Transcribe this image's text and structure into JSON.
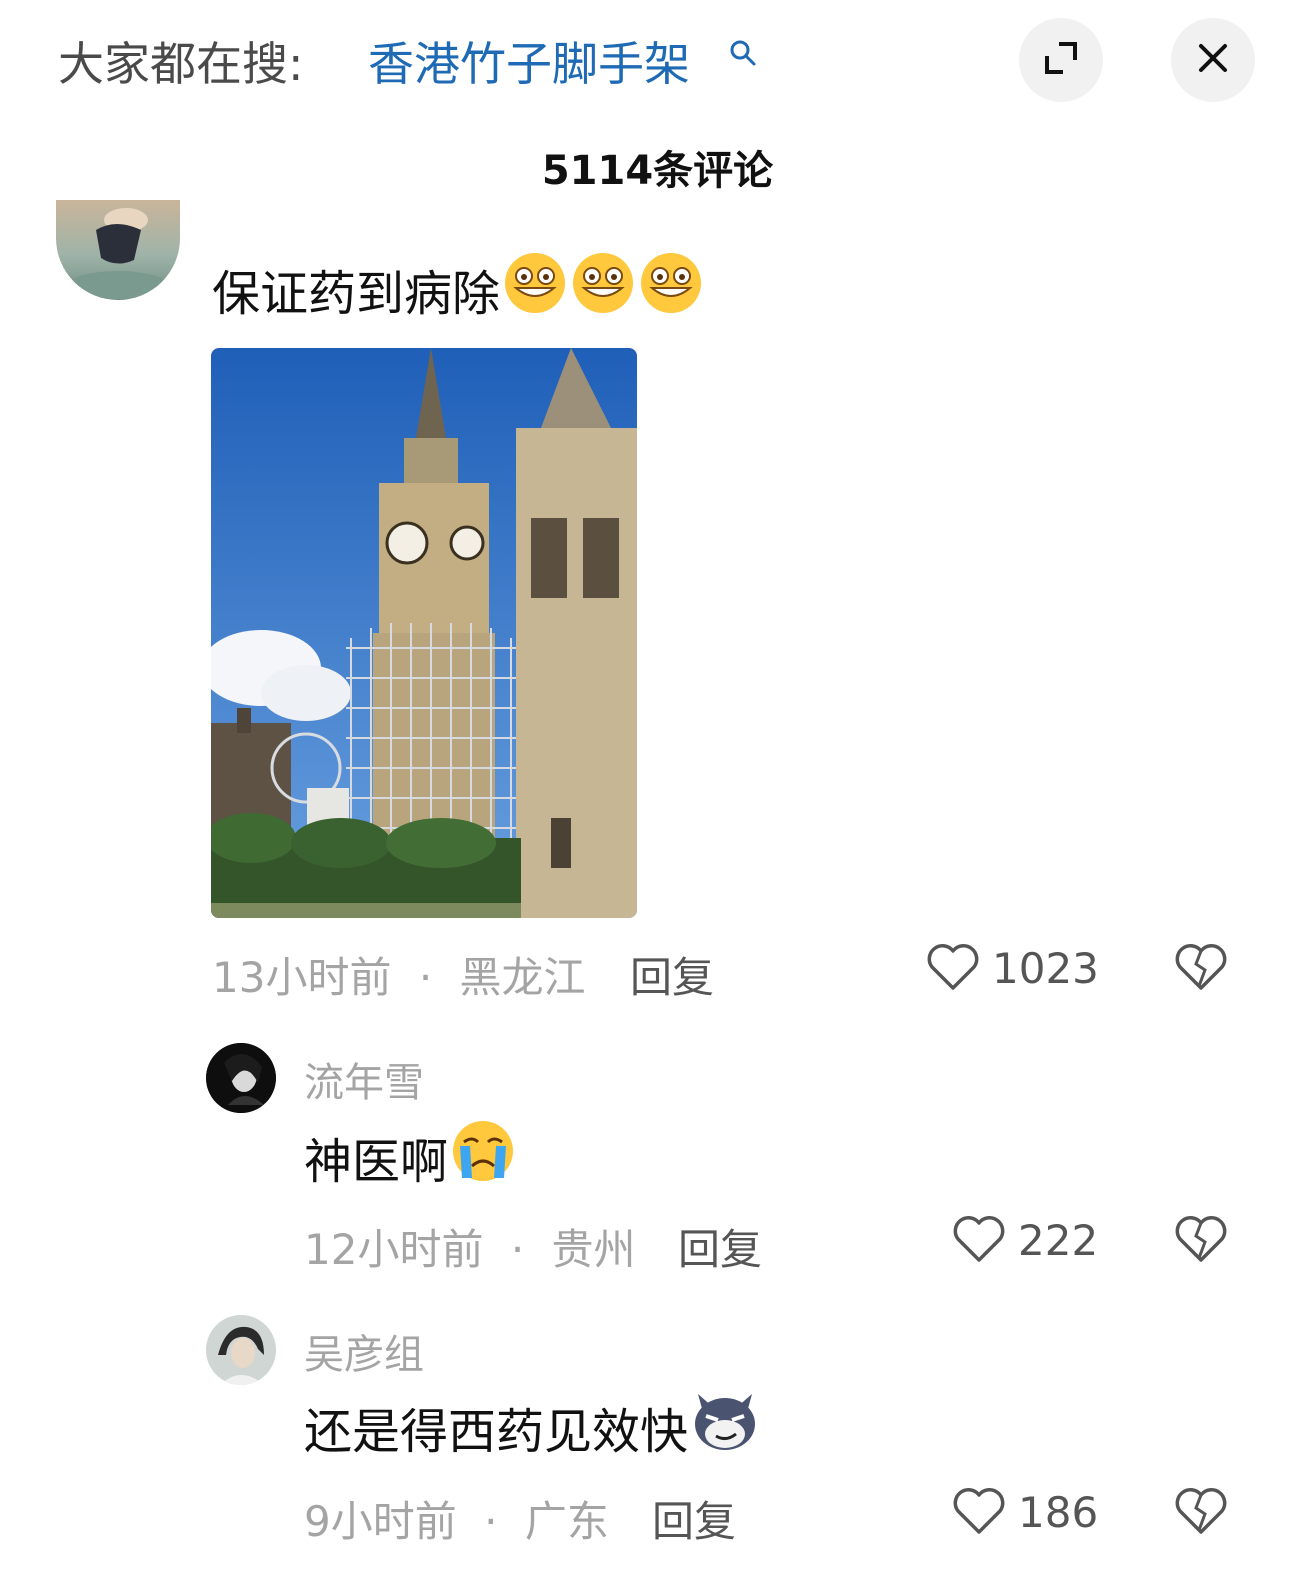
{
  "header": {
    "search_prefix": "大家都在搜:",
    "search_term": "香港竹子脚手架",
    "search_icon": "search-icon",
    "expand_icon": "expand-icon",
    "close_icon": "close-icon"
  },
  "comments_title": "5114条评论",
  "main_comment": {
    "text": "保证药到病除",
    "emojis": [
      "grin-emoji",
      "grin-emoji",
      "grin-emoji"
    ],
    "image": "big-ben-scaffolding-photo",
    "time": "13小时前",
    "location": "黑龙江",
    "separator": "·",
    "reply_label": "回复",
    "likes": "1023"
  },
  "replies": [
    {
      "username": "流年雪",
      "text": "神医啊",
      "emoji": "crying-emoji",
      "time": "12小时前",
      "location": "贵州",
      "separator": "·",
      "reply_label": "回复",
      "likes": "222"
    },
    {
      "username": "吴彦组",
      "text": "还是得西药见效快",
      "emoji": "wolf-smirk-emoji",
      "time": "9小时前",
      "location": "广东",
      "separator": "·",
      "reply_label": "回复",
      "likes": "186"
    }
  ],
  "colors": {
    "link_blue": "#1f6ab4",
    "meta_gray": "#a4a4a4",
    "button_bg": "#f1f1f1"
  }
}
